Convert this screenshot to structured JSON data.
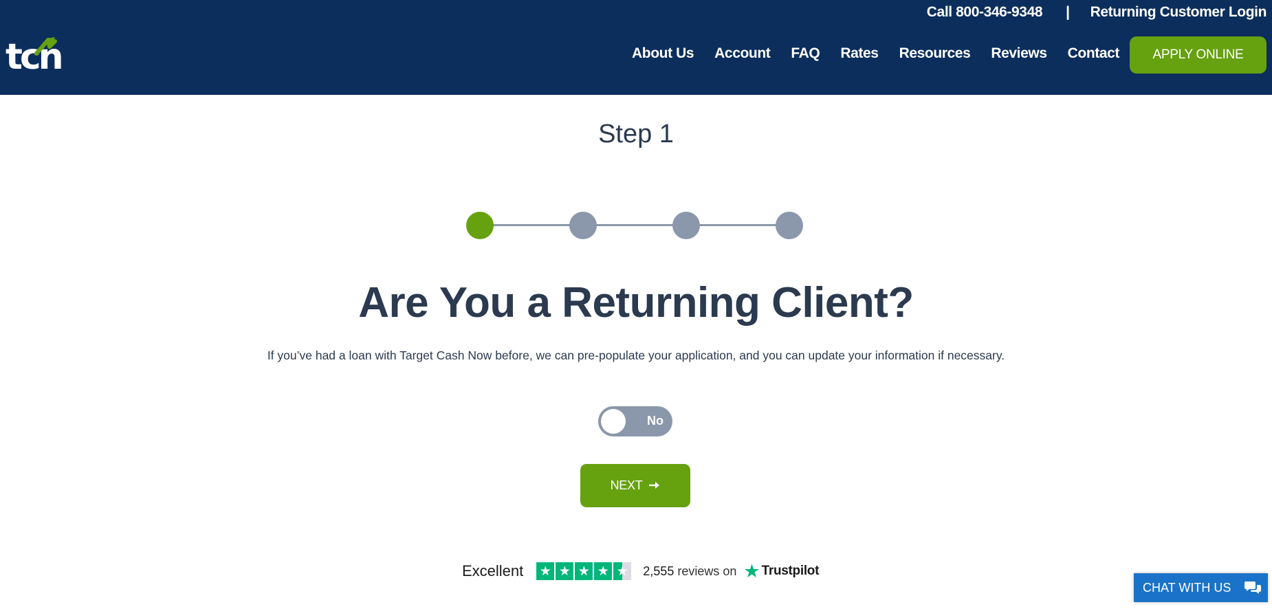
{
  "header": {
    "logo_text": "tcn",
    "phone": "Call 800-346-9348",
    "separator": "|",
    "returning_login": "Returning Customer Login",
    "nav": [
      "About Us",
      "Account",
      "FAQ",
      "Rates",
      "Resources",
      "Reviews",
      "Contact"
    ],
    "apply_label": "APPLY ONLINE"
  },
  "main": {
    "step_title": "Step 1",
    "progress": {
      "total_steps": 4,
      "current_step": 1
    },
    "headline": "Are You a Returning Client?",
    "description": "If you’ve had a loan with Target Cash Now before, we can pre-populate your application, and you can update your information if necessary.",
    "toggle_label": "No",
    "next_label": "NEXT",
    "next_icon": "arrow-right-icon"
  },
  "trustpilot": {
    "rating_label": "Excellent",
    "stars": 4.5,
    "review_count": "2,555",
    "reviews_text": "reviews on",
    "brand": "Trustpilot"
  },
  "chat": {
    "label": "CHAT WITH US",
    "icon": "chat-bubbles-icon"
  },
  "colors": {
    "header_bg": "#0c2e5c",
    "accent_green": "#66a10f",
    "inactive_gray": "#8b97aa",
    "text_dark": "#2b3a4f",
    "trustpilot_green": "#00b67a",
    "chat_blue": "#1a73c8"
  }
}
